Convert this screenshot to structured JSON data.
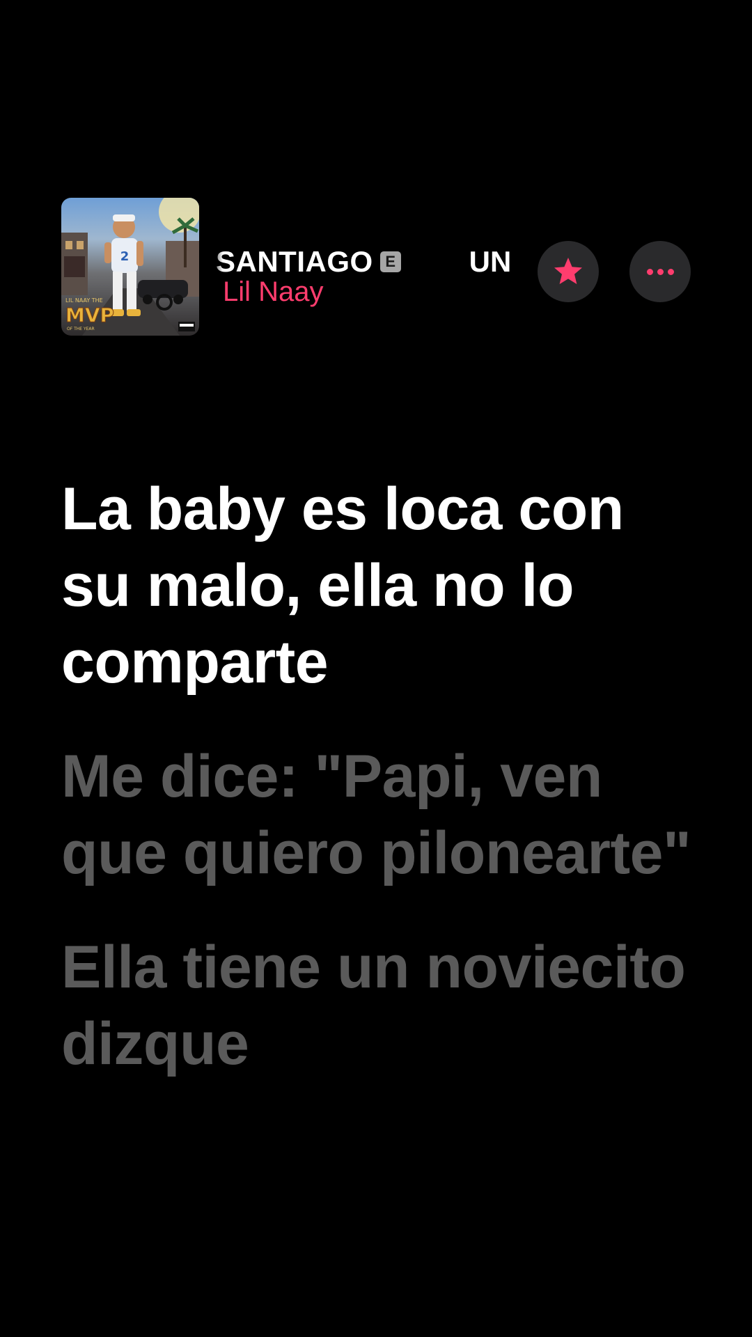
{
  "now_playing": {
    "song_title": "SANTIAGO",
    "explicit_badge": "E",
    "next_title_fragment": "UN",
    "artist": "Lil Naay",
    "artwork": {
      "description_text": "MVP"
    },
    "buttons": {
      "favorite_icon": "star-icon",
      "more_icon": "ellipsis-icon"
    }
  },
  "lyrics": {
    "active": "La baby es loca con su malo, ella no lo comparte",
    "upcoming": [
      "Me dice: \"Papi, ven que quiero pilonearte\"",
      "Ella tiene un noviecito dizque"
    ]
  },
  "colors": {
    "background": "#000000",
    "accent": "#ff3d6e",
    "lyric_active": "#ffffff",
    "lyric_upcoming": "#5a5a5a",
    "button_bg": "#2a2a2c"
  }
}
